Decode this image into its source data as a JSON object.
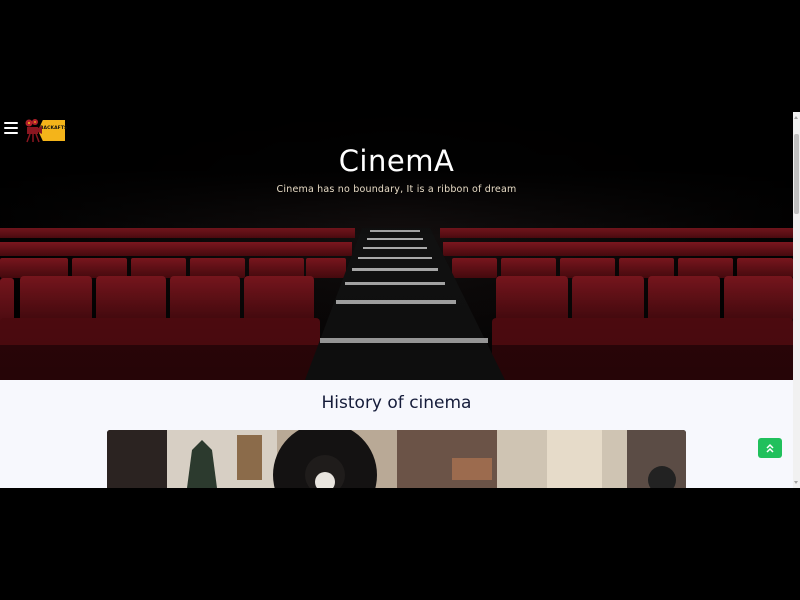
{
  "header": {
    "menu_icon": "hamburger-menu-icon",
    "logo_text": "BACKAFTS",
    "logo_icon": "film-camera-icon"
  },
  "hero": {
    "title": "CinemA",
    "subtitle": "Cinema has no boundary, It is a ribbon of dream"
  },
  "history": {
    "heading": "History of cinema"
  },
  "scroll_top": {
    "icon": "double-chevron-up-icon"
  },
  "colors": {
    "seat_red": "#8a1620",
    "scroll_top_bg": "#20c05c",
    "section_bg": "#f7f8fd",
    "heading": "#151c3a",
    "logo_yellow": "#f4b41a"
  }
}
